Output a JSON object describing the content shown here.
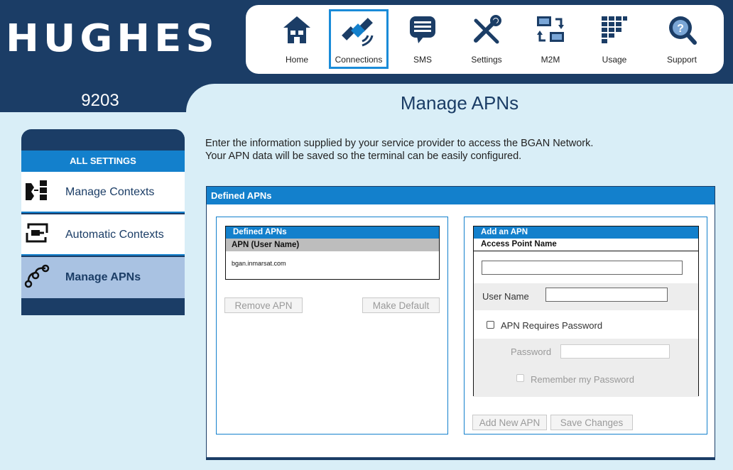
{
  "header": {
    "logo": "HUGHES",
    "model": "9203",
    "page_title": "Manage APNs"
  },
  "toolbar": [
    {
      "label": "Home",
      "icon": "home-icon"
    },
    {
      "label": "Connections",
      "icon": "satellite-icon",
      "active": true
    },
    {
      "label": "SMS",
      "icon": "sms-icon"
    },
    {
      "label": "Settings",
      "icon": "settings-tools-icon"
    },
    {
      "label": "M2M",
      "icon": "m2m-icon"
    },
    {
      "label": "Usage",
      "icon": "usage-icon"
    },
    {
      "label": "Support",
      "icon": "support-icon"
    }
  ],
  "sidebar": {
    "heading": "ALL SETTINGS",
    "items": [
      {
        "label": "Manage Contexts",
        "icon": "contexts-icon"
      },
      {
        "label": "Automatic Contexts",
        "icon": "automatic-contexts-icon"
      },
      {
        "label": "Manage APNs",
        "icon": "apn-icon",
        "active": true
      }
    ]
  },
  "intro": {
    "line1": "Enter the information supplied by your service provider to access the BGAN Network.",
    "line2": "Your APN data will be saved so the terminal can be easily configured."
  },
  "panel": {
    "heading": "Defined APNs",
    "list": {
      "heading": "Defined APNs",
      "column": "APN (User Name)",
      "rows": [
        "bgan.inmarsat.com"
      ],
      "remove_label": "Remove APN",
      "default_label": "Make Default"
    },
    "add": {
      "heading": "Add an APN",
      "apn_label": "Access Point Name",
      "apn_value": "",
      "username_label": "User Name",
      "username_value": "",
      "requires_password_label": "APN Requires Password",
      "password_label": "Password",
      "remember_label": "Remember my Password",
      "add_label": "Add New APN",
      "save_label": "Save Changes"
    }
  },
  "colors": {
    "navy": "#1b3d66",
    "accent_blue": "#1380cc",
    "background": "#d9eef7",
    "active_sidebar": "#a9c2e2"
  }
}
